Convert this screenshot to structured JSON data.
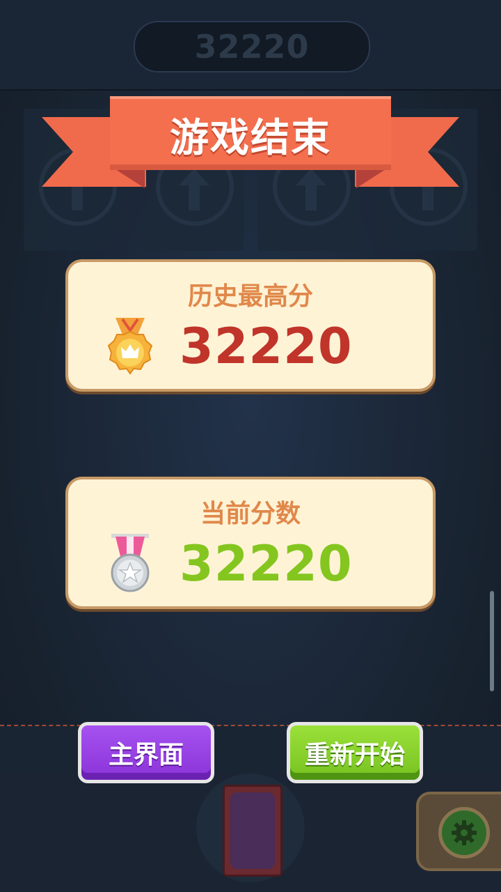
{
  "top_score": "32220",
  "title": "游戏结束",
  "best": {
    "label": "历史最高分",
    "value": "32220",
    "medal_icon": "gold-crown-medal-icon"
  },
  "current": {
    "label": "当前分数",
    "value": "32220",
    "medal_icon": "silver-star-medal-icon"
  },
  "buttons": {
    "home": "主界面",
    "restart": "重新开始"
  },
  "colors": {
    "ribbon": "#f46f4e",
    "best_value": "#c0342a",
    "current_value": "#84c61f",
    "card_bg": "#fff3d6",
    "home_button": "#9a45e6",
    "restart_button": "#86d02c"
  }
}
